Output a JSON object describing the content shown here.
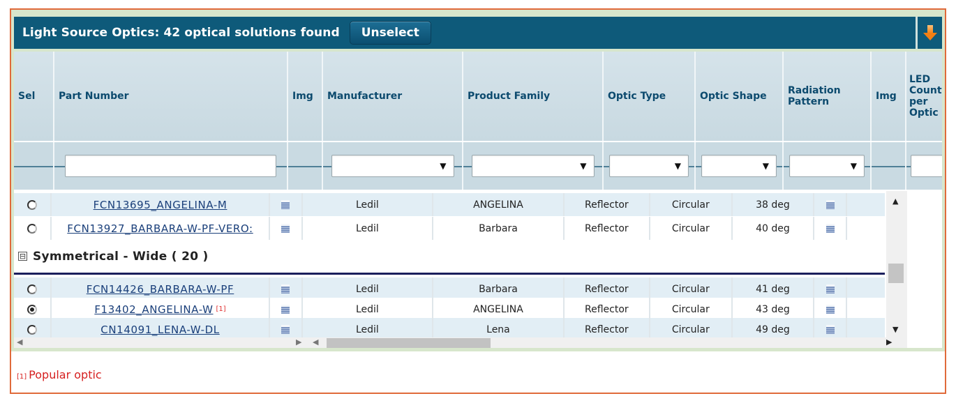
{
  "header": {
    "title": "Light Source Optics: 42 optical solutions found",
    "unselect_label": "Unselect",
    "export_icon": "download-arrow-icon"
  },
  "columns": [
    {
      "key": "sel",
      "label": "Sel"
    },
    {
      "key": "part_number",
      "label": "Part Number"
    },
    {
      "key": "img1",
      "label": "Img"
    },
    {
      "key": "manufacturer",
      "label": "Manufacturer"
    },
    {
      "key": "product_family",
      "label": "Product Family"
    },
    {
      "key": "optic_type",
      "label": "Optic Type"
    },
    {
      "key": "optic_shape",
      "label": "Optic Shape"
    },
    {
      "key": "radiation_pattern",
      "label": "Radiation Pattern"
    },
    {
      "key": "img2",
      "label": "Img"
    },
    {
      "key": "led_count",
      "label": "LED Count per Optic"
    }
  ],
  "filters": {
    "part_number": "",
    "manufacturer": "",
    "product_family": "",
    "optic_type": "",
    "optic_shape": "",
    "radiation_pattern": "",
    "led_count": ""
  },
  "rows_before_group": [
    {
      "selected": false,
      "part_number": "FCN13695_ANGELINA-M",
      "popular": false,
      "manufacturer": "Ledil",
      "product_family": "ANGELINA",
      "optic_type": "Reflector",
      "optic_shape": "Circular",
      "radiation_pattern": "38 deg"
    },
    {
      "selected": false,
      "part_number": "FCN13927_BARBARA-W-PF-VERO:",
      "popular": false,
      "manufacturer": "Ledil",
      "product_family": "Barbara",
      "optic_type": "Reflector",
      "optic_shape": "Circular",
      "radiation_pattern": "40 deg"
    }
  ],
  "group": {
    "label": "Symmetrical - Wide ( 20 )",
    "expanded": true,
    "toggle_symbol": "⊟"
  },
  "rows_in_group": [
    {
      "selected": false,
      "part_number": "FCN14426_BARBARA-W-PF",
      "popular": false,
      "manufacturer": "Ledil",
      "product_family": "Barbara",
      "optic_type": "Reflector",
      "optic_shape": "Circular",
      "radiation_pattern": "41 deg"
    },
    {
      "selected": true,
      "part_number": "F13402_ANGELINA-W",
      "popular": true,
      "popular_mark": "[1]",
      "manufacturer": "Ledil",
      "product_family": "ANGELINA",
      "optic_type": "Reflector",
      "optic_shape": "Circular",
      "radiation_pattern": "43 deg"
    },
    {
      "selected": false,
      "part_number": "CN14091_LENA-W-DL",
      "popular": false,
      "manufacturer": "Ledil",
      "product_family": "Lena",
      "optic_type": "Reflector",
      "optic_shape": "Circular",
      "radiation_pattern": "49 deg"
    }
  ],
  "footnote": {
    "mark": "[1]",
    "text": "Popular optic"
  },
  "colors": {
    "title_bar": "#0e5a7a",
    "frame_border": "#e06a3a",
    "header_text": "#0c4a6e",
    "link": "#1a3f7a",
    "popular_mark": "#e03030",
    "row_alt": "#e2eef5"
  }
}
